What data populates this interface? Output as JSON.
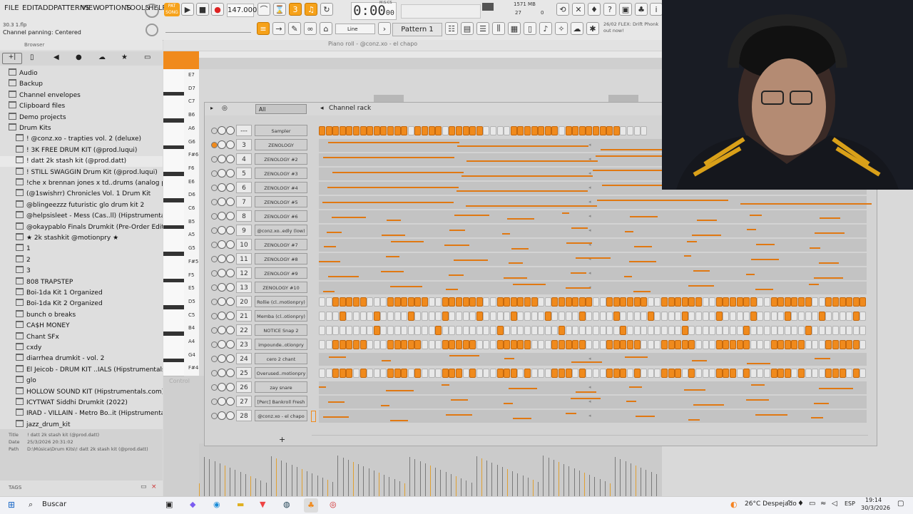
{
  "menu": [
    "FILE",
    "EDIT",
    "ADD",
    "PATTERNS",
    "VIEW",
    "OPTIONS",
    "TOOLS",
    "HELP"
  ],
  "transport": {
    "tempo": "147.000",
    "time": "0:00",
    "time_small": "00",
    "time_unit": "M:S:CS",
    "pattern": "Pattern 1",
    "snap": "Line",
    "memory": "1571 MB",
    "cpu": "27",
    "polyphony": "0"
  },
  "hint": {
    "file": "30.3 1.flp",
    "status": "Channel panning: Centered"
  },
  "news": {
    "line1": "26/02 FLEX: Drift Phonk",
    "line2": "out now!"
  },
  "browser": {
    "title": "Browser",
    "items": [
      {
        "label": "Audio",
        "indent": 0,
        "type": "user"
      },
      {
        "label": "Backup",
        "indent": 0
      },
      {
        "label": "Channel envelopes",
        "indent": 0
      },
      {
        "label": "Clipboard files",
        "indent": 0
      },
      {
        "label": "Demo projects",
        "indent": 0
      },
      {
        "label": "Drum Kits",
        "indent": 0
      },
      {
        "label": "! @conz.xo - trapties vol. 2 (deluxe)",
        "indent": 1
      },
      {
        "label": "! 3K FREE DRUM KIT (@prod.luqui)",
        "indent": 1
      },
      {
        "label": "! datt 2k stash kit (@prod.datt)",
        "indent": 1
      },
      {
        "label": "! STILL SWAGGIN Drum Kit (@prod.luqui)",
        "indent": 1
      },
      {
        "label": "!che x brennan jones x td..drums (analog princess)",
        "indent": 1
      },
      {
        "label": "(@1swishrr) Chronicles Vol. 1 Drum Kit",
        "indent": 1
      },
      {
        "label": "@blingeezzz futuristic glo drum kit 2",
        "indent": 1
      },
      {
        "label": "@helpsisleet - Mess (Cas..ll) (Hipstrumentals.com)",
        "indent": 1
      },
      {
        "label": "@okaypablo Finals Drumkit (Pre-Order Edition)",
        "indent": 1
      },
      {
        "label": "★ 2k stashkit @motionpry ★",
        "indent": 1
      },
      {
        "label": "1",
        "indent": 1
      },
      {
        "label": "2",
        "indent": 1
      },
      {
        "label": "3",
        "indent": 1
      },
      {
        "label": "808 TRAPSTEP",
        "indent": 1
      },
      {
        "label": "Boi-1da Kit 1 Organized",
        "indent": 1
      },
      {
        "label": "Boi-1da Kit 2 Organized",
        "indent": 1
      },
      {
        "label": "bunch o breaks",
        "indent": 1
      },
      {
        "label": "CA$H MONEY",
        "indent": 1
      },
      {
        "label": "Chant SFx",
        "indent": 1
      },
      {
        "label": "cxdy",
        "indent": 1
      },
      {
        "label": "diarrhea drumkit - vol. 2",
        "indent": 1
      },
      {
        "label": "El Jeicob - DRUM KIT ..IALS (Hipstrumentals.com)",
        "indent": 1
      },
      {
        "label": "glo",
        "indent": 1
      },
      {
        "label": "HOLLOW SOUND KIT (Hipstrumentals.com)",
        "indent": 1
      },
      {
        "label": "ICYTWAT Siddhi Drumkit (2022)",
        "indent": 1
      },
      {
        "label": "IRAD - VILLAIN - Metro Bo..it (Hipstrumentals.com)",
        "indent": 1
      },
      {
        "label": "jazz_drum_kit",
        "indent": 1
      }
    ],
    "info": {
      "title_label": "Title",
      "title": "! datt 2k stash kit (@prod.datt)",
      "date_label": "Date",
      "date": "25/3/2026 20:31:02",
      "path_label": "Path",
      "path": "D:\\Música\\Drum Kits\\! datt 2k stash kit (@prod.datt)"
    },
    "tags": "TAGS"
  },
  "piano_roll": {
    "title": "Piano roll - @conz.xo - el chapo",
    "keys": [
      "E7",
      "D7",
      "C7",
      "B6",
      "A6",
      "G6",
      "F#6",
      "F6",
      "E6",
      "D6",
      "C6",
      "B5",
      "A5",
      "G5",
      "F#5",
      "F5",
      "E5",
      "D5",
      "C5",
      "B4",
      "A4",
      "G4",
      "F#4"
    ],
    "control": "Control"
  },
  "channel_rack": {
    "title": "Channel rack",
    "filter": "All",
    "channels": [
      {
        "num": "---",
        "name": "Sampler",
        "mode": "steps",
        "pattern": "111111111111101111011111000011111110111111110000"
      },
      {
        "num": "3",
        "name": "ZENOLOGY",
        "mode": "notes"
      },
      {
        "num": "4",
        "name": "ZENOLOGY #2",
        "mode": "notes"
      },
      {
        "num": "5",
        "name": "ZENOLOGY #3",
        "mode": "notes"
      },
      {
        "num": "6",
        "name": "ZENOLOGY #4",
        "mode": "notes"
      },
      {
        "num": "7",
        "name": "ZENOLOGY #5",
        "mode": "notes"
      },
      {
        "num": "8",
        "name": "ZENOLOGY #6",
        "mode": "notes"
      },
      {
        "num": "9",
        "name": "@conz.xo..edly (low)",
        "mode": "notes"
      },
      {
        "num": "10",
        "name": "ZENOLOGY #7",
        "mode": "notes"
      },
      {
        "num": "11",
        "name": "ZENOLOGY #8",
        "mode": "notes"
      },
      {
        "num": "12",
        "name": "ZENOLOGY #9",
        "mode": "notes"
      },
      {
        "num": "13",
        "name": "ZENOLOGY #10",
        "mode": "notes"
      },
      {
        "num": "20",
        "name": "Rollie (cl..motionpry)",
        "mode": "steps",
        "pattern": "00111110001111110011111100111111001111110011111100111111001111110011111100111111"
      },
      {
        "num": "21",
        "name": "Memba (cl..otionpry)",
        "mode": "steps",
        "pattern": "00010000100001000010000100001000010000100001000010000100001000010000100001000010"
      },
      {
        "num": "22",
        "name": "NOTICE Snap 2",
        "mode": "steps",
        "pattern": "00000000100000000100000000100000000100000000100000000100000000100000000100000000"
      },
      {
        "num": "23",
        "name": "impounde..otionpry",
        "mode": "steps",
        "pattern": "00111110001111100011111000111110001111100011111000111110001111100011111000111110"
      },
      {
        "num": "24",
        "name": "cero 2 chant",
        "mode": "notes"
      },
      {
        "num": "25",
        "name": "Overused..motionpry",
        "mode": "steps",
        "pattern": "00111010001110100011101000111010001110100011101000111010001110100011101000111010"
      },
      {
        "num": "26",
        "name": "zay snare",
        "mode": "notes"
      },
      {
        "num": "27",
        "name": "[Perc] Bankroll Fresh",
        "mode": "notes"
      },
      {
        "num": "28",
        "name": "@conz.xo - el chapo",
        "mode": "notes"
      }
    ]
  },
  "taskbar": {
    "search": "Buscar",
    "weather": "26°C  Despejado",
    "lang": "ESP",
    "time": "19:14",
    "date": "30/3/2026"
  },
  "colors": {
    "accent": "#f08a1c",
    "rack_bg": "#d3d3d3"
  }
}
